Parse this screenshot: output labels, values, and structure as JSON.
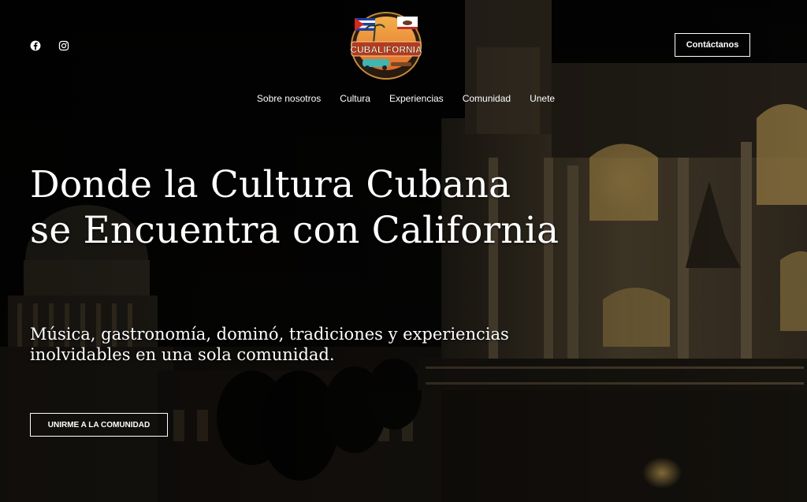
{
  "header": {
    "social": [
      {
        "name": "facebook-icon"
      },
      {
        "name": "instagram-icon"
      }
    ],
    "logo": {
      "text": "CUBALIFORNIA"
    },
    "contact_label": "Contáctanos"
  },
  "nav": {
    "items": [
      {
        "label": "Sobre nosotros"
      },
      {
        "label": "Cultura"
      },
      {
        "label": "Experiencias"
      },
      {
        "label": "Comunidad"
      },
      {
        "label": "Unete"
      }
    ]
  },
  "hero": {
    "headline_line1": "Donde la Cultura Cubana",
    "headline_line2": "se Encuentra con California",
    "subtitle_line1": "Música, gastronomía, dominó, tradiciones y experiencias",
    "subtitle_line2": "inolvidables en una sola comunidad.",
    "cta_label": "UNIRME A LA COMUNIDAD"
  },
  "colors": {
    "background": "#000000",
    "text": "#ffffff",
    "warm_light": "#c9a55a"
  }
}
